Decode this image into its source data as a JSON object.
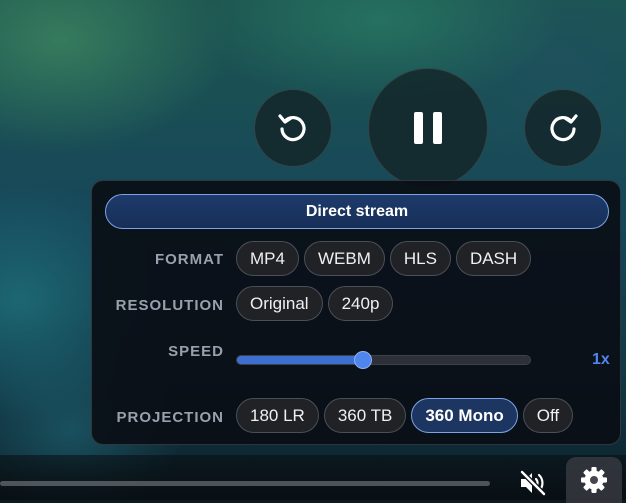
{
  "player": {
    "controls": {
      "rewind_icon": "rotate-ccw-icon",
      "play_pause_icon": "pause-icon",
      "forward_icon": "rotate-cw-icon"
    },
    "settings_panel": {
      "stream_label": "Direct stream",
      "format": {
        "label": "FORMAT",
        "options": [
          "MP4",
          "WEBM",
          "HLS",
          "DASH"
        ]
      },
      "resolution": {
        "label": "RESOLUTION",
        "options": [
          "Original",
          "240p"
        ]
      },
      "speed": {
        "label": "SPEED",
        "value_label": "1x",
        "slider_fraction": 0.43
      },
      "projection": {
        "label": "PROJECTION",
        "options": [
          "180 LR",
          "360 TB",
          "360 Mono",
          "Off"
        ],
        "selected": "360 Mono"
      }
    },
    "bottom_bar": {
      "mute_icon": "volume-muted-icon",
      "settings_icon": "gear-icon"
    }
  },
  "colors": {
    "accent": "#4f86ee",
    "selected_bg": "#1c3561",
    "selected_border": "#7da3e6",
    "panel_bg": "#0a0e16"
  }
}
